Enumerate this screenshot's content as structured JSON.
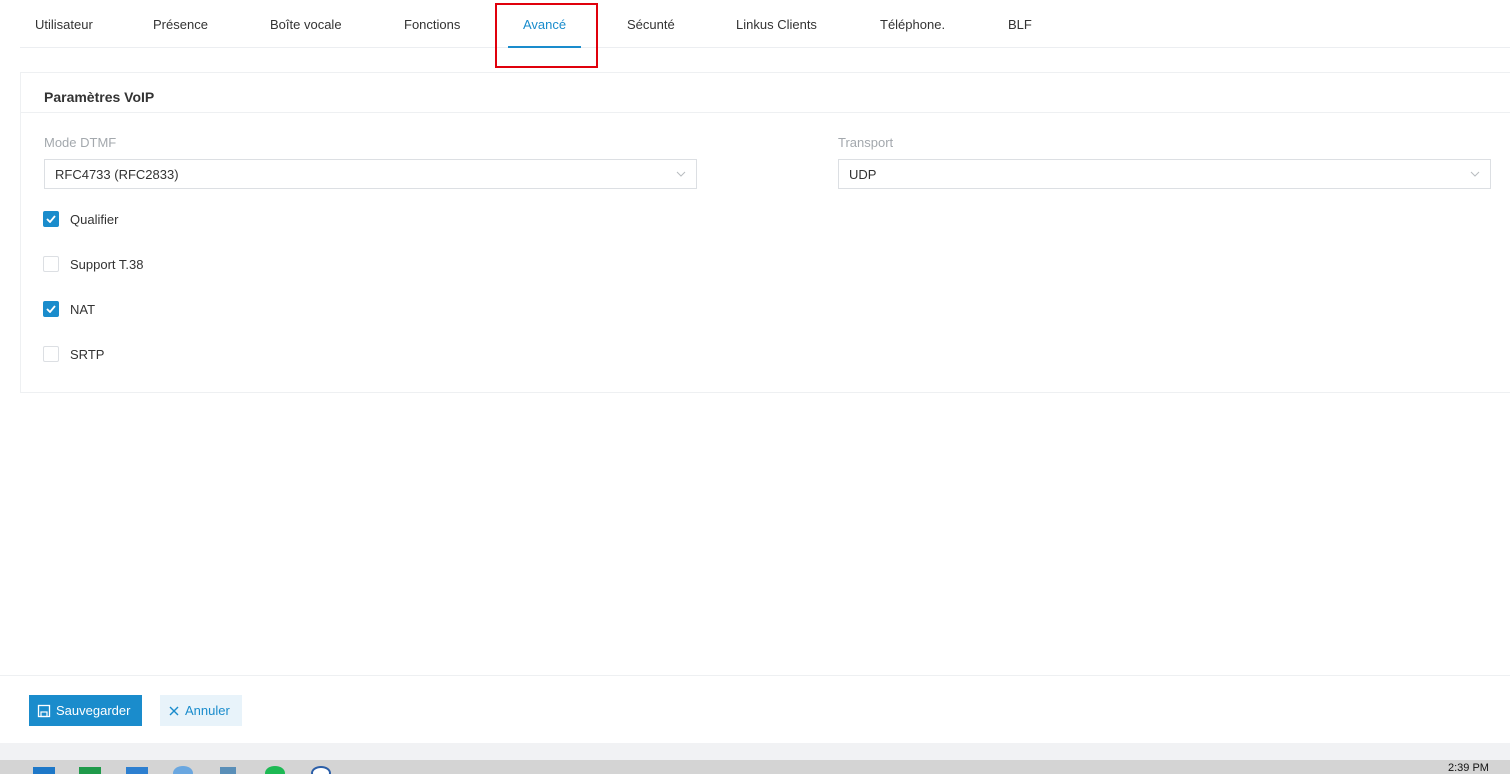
{
  "tabs": [
    {
      "label": "Utilisateur",
      "active": false
    },
    {
      "label": "Présence",
      "active": false
    },
    {
      "label": "Boîte vocale",
      "active": false
    },
    {
      "label": "Fonctions",
      "active": false
    },
    {
      "label": "Avancé",
      "active": true
    },
    {
      "label": "Sécunté",
      "active": false
    },
    {
      "label": "Linkus Clients",
      "active": false
    },
    {
      "label": "Téléphone.",
      "active": false
    },
    {
      "label": "BLF",
      "active": false
    }
  ],
  "section": {
    "title": "Paramètres VoIP",
    "dtmf": {
      "label": "Mode DTMF",
      "value": "RFC4733 (RFC2833)"
    },
    "transport": {
      "label": "Transport",
      "value": "UDP"
    },
    "checkboxes": [
      {
        "label": "Qualifier",
        "checked": true
      },
      {
        "label": "Support T.38",
        "checked": false
      },
      {
        "label": "NAT",
        "checked": true
      },
      {
        "label": "SRTP",
        "checked": false
      }
    ]
  },
  "footer": {
    "save_label": "Sauvegarder",
    "cancel_label": "Annuler"
  },
  "colors": {
    "accent": "#1a8ccc",
    "highlight": "#e0000c"
  },
  "taskbar": {
    "icons": [
      "start-icon",
      "spreadsheet-icon",
      "files-icon",
      "browser-icon",
      "calculator-icon",
      "music-icon",
      "compass-icon"
    ],
    "clock": "2:39 PM"
  }
}
